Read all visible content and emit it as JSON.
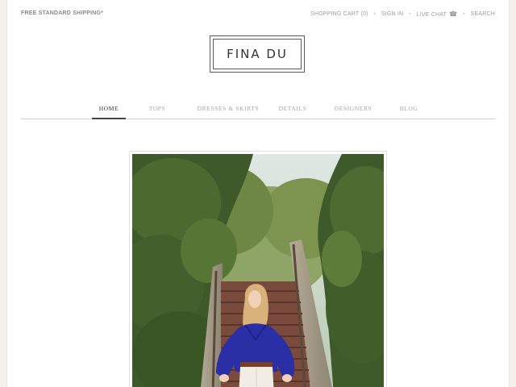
{
  "topbar": {
    "shipping": "FREE STANDARD SHIPPING*",
    "cart": "SHOPPING CART (0)",
    "sign_in": "SIGN IN",
    "live_chat": "LIVE CHAT",
    "search": "SEARCH",
    "separator": "•",
    "phone_icon": "☎"
  },
  "logo": {
    "text": "FINA DU"
  },
  "nav": {
    "items": [
      {
        "label": "HOME",
        "active": true
      },
      {
        "label": "TOPS"
      },
      {
        "label": "DRESSES & SKIRTS"
      },
      {
        "label": "DETAILS"
      },
      {
        "label": "DESIGNERS"
      },
      {
        "label": "BLOG"
      }
    ]
  },
  "hero": {
    "image": "model-on-garden-stairs-photo"
  },
  "colors": {
    "background": "#ffffff",
    "frame": "#f3f0ee",
    "text_muted": "#a09a96",
    "text_dark": "#333333",
    "rule": "#cfcfcf"
  }
}
